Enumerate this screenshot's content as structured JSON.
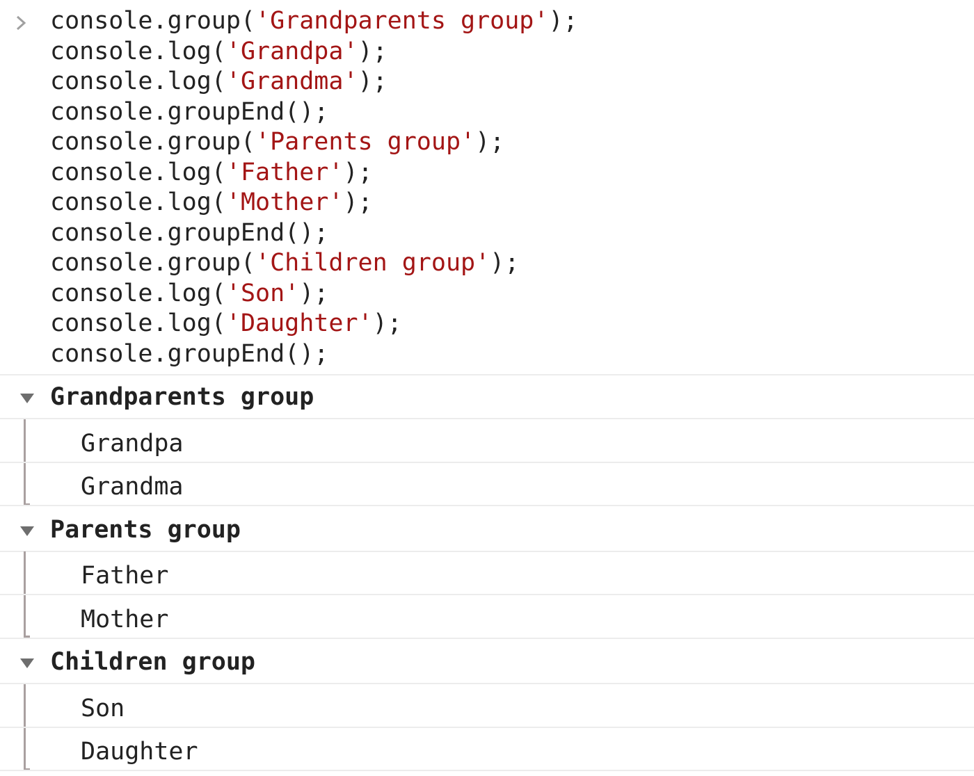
{
  "input": {
    "lines": [
      {
        "pre": "console.group(",
        "str": "'Grandparents group'",
        "post": ");"
      },
      {
        "pre": "console.log(",
        "str": "'Grandpa'",
        "post": ");"
      },
      {
        "pre": "console.log(",
        "str": "'Grandma'",
        "post": ");"
      },
      {
        "pre": "console.groupEnd();",
        "str": "",
        "post": ""
      },
      {
        "pre": "console.group(",
        "str": "'Parents group'",
        "post": ");"
      },
      {
        "pre": "console.log(",
        "str": "'Father'",
        "post": ");"
      },
      {
        "pre": "console.log(",
        "str": "'Mother'",
        "post": ");"
      },
      {
        "pre": "console.groupEnd();",
        "str": "",
        "post": ""
      },
      {
        "pre": "console.group(",
        "str": "'Children group'",
        "post": ");"
      },
      {
        "pre": "console.log(",
        "str": "'Son'",
        "post": ");"
      },
      {
        "pre": "console.log(",
        "str": "'Daughter'",
        "post": ");"
      },
      {
        "pre": "console.groupEnd();",
        "str": "",
        "post": ""
      }
    ]
  },
  "output": {
    "groups": [
      {
        "title": "Grandparents group",
        "items": [
          "Grandpa",
          "Grandma"
        ]
      },
      {
        "title": "Parents group",
        "items": [
          "Father",
          "Mother"
        ]
      },
      {
        "title": "Children group",
        "items": [
          "Son",
          "Daughter"
        ]
      }
    ]
  },
  "icons": {
    "prompt": "chevron-right-icon",
    "group_toggle": "triangle-down-icon"
  },
  "colors": {
    "string": "#a31515",
    "text": "#222222",
    "divider": "#ececec",
    "group_rail": "#a9a0a0",
    "caret": "#6e6e6e",
    "prompt": "#a0a0a0"
  }
}
